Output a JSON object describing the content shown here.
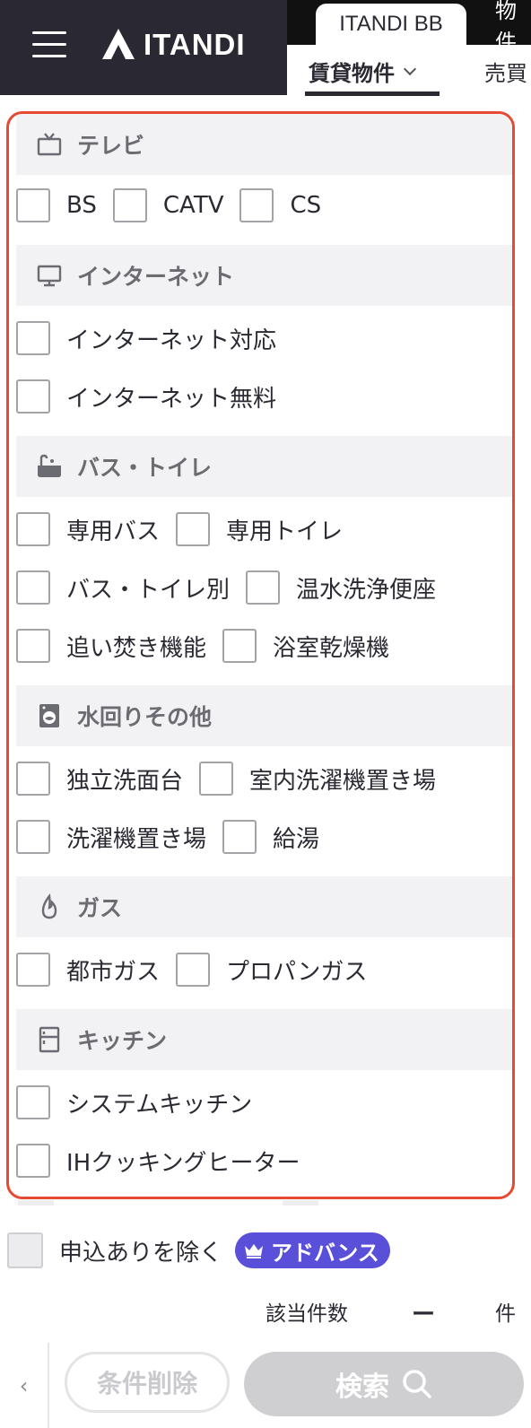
{
  "header": {
    "logo_text": "ITANDI",
    "top_tabs": [
      {
        "label": "ITANDI BB",
        "active": true
      },
      {
        "label": "物件"
      }
    ],
    "sub_tabs": [
      {
        "label": "賃貸物件",
        "active": true
      },
      {
        "label": "売買"
      }
    ]
  },
  "sections": [
    {
      "title": "テレビ",
      "icon": "tv-icon",
      "rows": [
        [
          "BS",
          "CATV",
          "CS"
        ]
      ]
    },
    {
      "title": "インターネット",
      "icon": "monitor-icon",
      "rows": [
        [
          "インターネット対応"
        ],
        [
          "インターネット無料"
        ]
      ]
    },
    {
      "title": "バス・トイレ",
      "icon": "bathtub-icon",
      "rows": [
        [
          "専用バス",
          "専用トイレ"
        ],
        [
          "バス・トイレ別",
          "温水洗浄便座"
        ],
        [
          "追い焚き機能",
          "浴室乾燥機"
        ]
      ]
    },
    {
      "title": "水回りその他",
      "icon": "washing-machine-icon",
      "rows": [
        [
          "独立洗面台",
          "室内洗濯機置き場"
        ],
        [
          "洗濯機置き場",
          "給湯"
        ]
      ]
    },
    {
      "title": "ガス",
      "icon": "flame-icon",
      "rows": [
        [
          "都市ガス",
          "プロパンガス"
        ]
      ]
    },
    {
      "title": "キッチン",
      "icon": "kitchen-icon",
      "rows": [
        [
          "システムキッチン"
        ],
        [
          "IHクッキングヒーター"
        ]
      ]
    }
  ],
  "footer": {
    "exclude_label": "申込ありを除く",
    "advance_badge": "アドバンス",
    "count_label": "該当件数",
    "count_value": "ー",
    "count_unit": "件",
    "back_label": "‹",
    "clear_label": "条件削除",
    "search_label": "検索"
  },
  "colors": {
    "header_bg": "#2a2832",
    "panel_border": "#e64a33",
    "section_bg": "#f2f2f4",
    "badge_bg": "#5a4fd8",
    "search_btn_bg": "#cfcfd2"
  }
}
